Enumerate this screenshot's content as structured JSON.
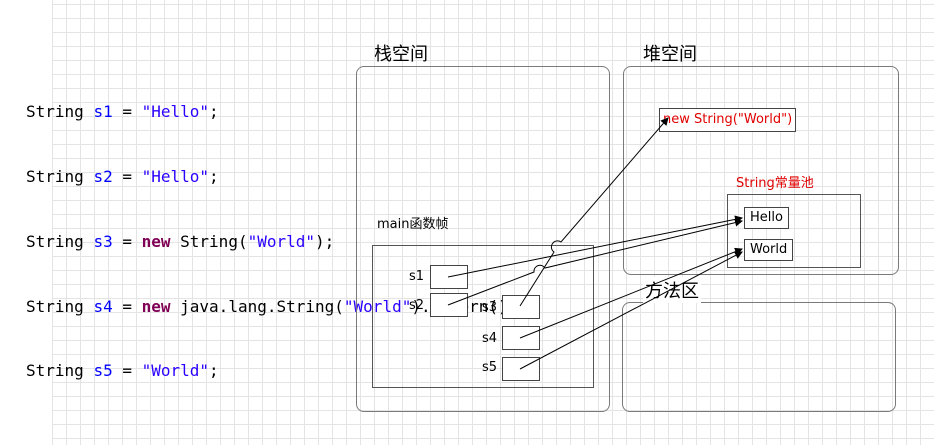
{
  "code": {
    "lines": [
      {
        "type": "String",
        "var": "s1",
        "eq": " = ",
        "pre": "",
        "kw": "",
        "mid": "",
        "str": "\"Hello\"",
        "tail": ";"
      },
      {
        "type": "String",
        "var": "s2",
        "eq": " = ",
        "pre": "",
        "kw": "",
        "mid": "",
        "str": "\"Hello\"",
        "tail": ";"
      },
      {
        "type": "String",
        "var": "s3",
        "eq": " = ",
        "kw": "new",
        "mid": " String(",
        "str": "\"World\"",
        "tail": ");"
      },
      {
        "type": "String",
        "var": "s4",
        "eq": " = ",
        "kw": "new",
        "mid": " java.lang.String(",
        "str": "\"World\"",
        "tail": ").intern();"
      },
      {
        "type": "String",
        "var": "s5",
        "eq": " = ",
        "kw": "",
        "mid": "",
        "str": "\"World\"",
        "tail": ";"
      }
    ]
  },
  "stack": {
    "title": "栈空间",
    "frame_title": "main函数帧",
    "slots": {
      "s1": "s1",
      "s2": "s2",
      "s3": "s3",
      "s4": "s4",
      "s5": "s5"
    }
  },
  "heap": {
    "title": "堆空间",
    "object": "new String(\"World\")",
    "pool_label": "String常量池",
    "pool_items": {
      "hello": "Hello",
      "world": "World"
    }
  },
  "method_area": {
    "title": "方法区"
  },
  "colors": {
    "keyword": "#7f0055",
    "variable": "#0000ff",
    "string": "#2a00ff",
    "heap_text": "#e00000",
    "border": "#7a7a7a"
  }
}
